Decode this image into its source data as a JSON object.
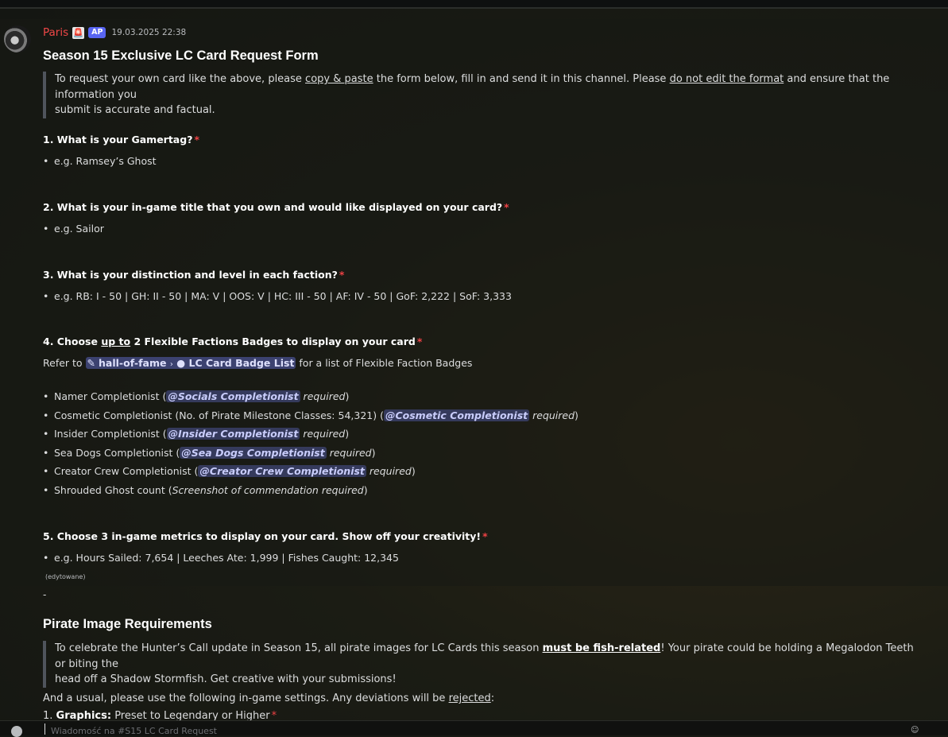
{
  "message": {
    "username": "Paris",
    "role_icon": "🚨",
    "tag": "AP",
    "timestamp": "19.03.2025 22:38"
  },
  "form": {
    "title": "Season 15 Exclusive LC Card Request Form",
    "intro": {
      "p1": "To request your own card like the above, please ",
      "copy_link": "copy & paste",
      "p2": " the form below, fill in and send it in this channel. Please ",
      "format_link": "do not edit the format",
      "p3": " and ensure that the information you",
      "p4": "submit is accurate and factual."
    },
    "q1": {
      "label": "1. What is your Gamertag?",
      "star": "*",
      "example": "e.g. Ramsey’s Ghost"
    },
    "q2": {
      "label": "2. What is your in-game title that you own and would like displayed on your card?",
      "star": "*",
      "example": "e.g. Sailor"
    },
    "q3": {
      "label": "3. What is your distinction and level in each faction?",
      "star": "*",
      "example": "e.g. RB: I - 50  |  GH: II - 50  |  MA: V  |  OOS: V  |  HC: III - 50  |  AF: IV - 50  |  GoF: 2,222  |  SoF: 3,333"
    },
    "q4": {
      "label_a": "4. Choose ",
      "label_u": "up to",
      "label_b": " 2 Flexible Factions Badges to display on your card",
      "star": "*",
      "refer_pre": "Refer to ",
      "channel": "hall-of-fame",
      "channel_sep": "›",
      "thread": "LC Card Badge List",
      "refer_post": " for a list of Flexible Faction Badges",
      "items": [
        {
          "text": "Namer Completionist (",
          "mention": "@Socials Completionist",
          "suffix": " required",
          "end": ")"
        },
        {
          "text": "Cosmetic Completionist (No. of Pirate Milestone Classes: 54,321) (",
          "mention": "@Cosmetic Completionist",
          "suffix": " required",
          "end": ")"
        },
        {
          "text": "Insider Completionist (",
          "mention": "@Insider Completionist",
          "suffix": " required",
          "end": ")"
        },
        {
          "text": "Sea Dogs Completionist (",
          "mention": "@Sea Dogs Completionist",
          "suffix": " required",
          "end": ")"
        },
        {
          "text": "Creator Crew Completionist (",
          "mention": "@Creator Crew Completionist",
          "suffix": " required",
          "end": ")"
        }
      ],
      "last_item": {
        "text": "Shrouded Ghost count (",
        "italic": "Screenshot of commendation required",
        "end": ")"
      }
    },
    "q5": {
      "label": "5. Choose 3 in-game metrics to display on your card. Show off your creativity!",
      "star": "*",
      "example": "e.g. Hours Sailed: 7,654  |  Leeches Ate: 1,999  |   Fishes Caught: 12,345"
    },
    "credit": "(edytowane)",
    "dash": "-"
  },
  "pirate": {
    "title": "Pirate Image Requirements",
    "quote_a": "To celebrate the Hunter’s Call update in Season 15, all pirate images for LC Cards this season ",
    "quote_b": "must be fish-related",
    "quote_c": "! Your pirate could be holding a Megalodon Teeth or biting the",
    "quote_d": "head off a Shadow Stormfish. Get creative with your submissions!",
    "settings_a": "And a usual, please use the following in-game settings. Any deviations will be ",
    "settings_u": "rejected",
    "settings_b": ":",
    "setting1_num": "1. ",
    "setting1_label": "Graphics:",
    "setting1_value": " Preset to Legendary or Higher",
    "setting1_star": "*"
  },
  "composer": {
    "placeholder": "Wiadomość na #S15 LC Card Request"
  }
}
